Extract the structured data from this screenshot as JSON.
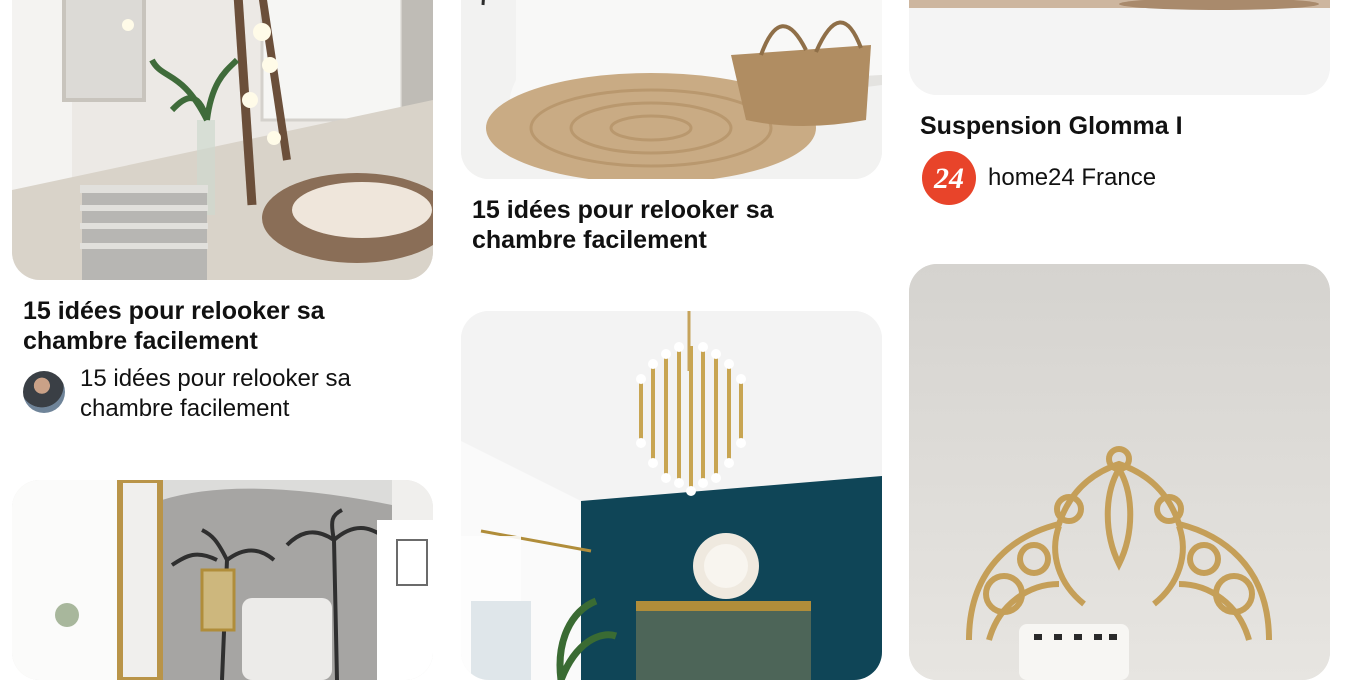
{
  "pins": [
    {
      "title": "15 idées pour relooker sa chambre facilement",
      "source": "15 idées pour relooker sa chambre facilement",
      "image": "bedroom-corner-ladder-fairy-lights"
    },
    {
      "title": "15 idées pour relooker sa chambre facilement",
      "image": "white-bed-jute-rug-wicker-bag"
    },
    {
      "title": "Suspension Glomma I",
      "source": "home24 France",
      "badge": "24",
      "badge_color": "#e8442a",
      "image": "wood-floor"
    },
    {
      "image": "bedroom-palm-wallpaper-gold-mirror"
    },
    {
      "image": "teal-wall-brass-chandelier-bedroom"
    },
    {
      "image": "rattan-peacock-headboard"
    }
  ]
}
